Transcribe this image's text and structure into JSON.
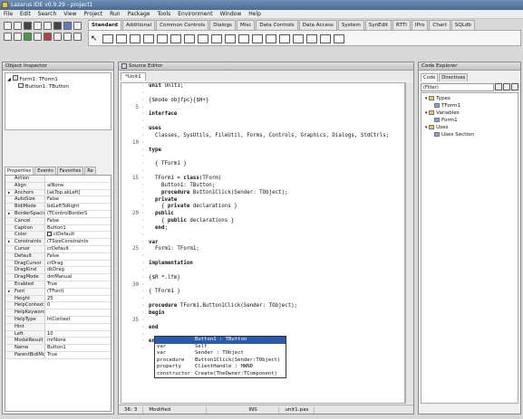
{
  "title": "Lazarus IDE v0.9.29 - project1",
  "menu": [
    "File",
    "Edit",
    "Search",
    "View",
    "Project",
    "Run",
    "Package",
    "Tools",
    "Environment",
    "Window",
    "Help"
  ],
  "palette_tabs": [
    "Standard",
    "Additional",
    "Common Controls",
    "Dialogs",
    "Misc",
    "Data Controls",
    "Data Access",
    "System",
    "SynEdit",
    "RTTI",
    "IPro",
    "Chart",
    "SQLdb"
  ],
  "palette_active": "Standard",
  "object_inspector": {
    "title": "Object Inspector",
    "tree": [
      "Form1: TForm1",
      "Button1: TButton"
    ],
    "tabs": [
      "Properties",
      "Events",
      "Favorites",
      "Re"
    ],
    "props": [
      {
        "k": "Action",
        "v": ""
      },
      {
        "k": "Align",
        "v": "alNone"
      },
      {
        "k": "Anchors",
        "v": "[akTop,akLeft]",
        "tri": "▸"
      },
      {
        "k": "AutoSize",
        "v": "False"
      },
      {
        "k": "BidiMode",
        "v": "bdLeftToRight"
      },
      {
        "k": "BorderSpacing",
        "v": "(TControlBorderS",
        "tri": "▸"
      },
      {
        "k": "Cancel",
        "v": "False"
      },
      {
        "k": "Caption",
        "v": "Button1"
      },
      {
        "k": "Color",
        "v": "clDefault"
      },
      {
        "k": "Constraints",
        "v": "(TSizeConstraints",
        "tri": "▸"
      },
      {
        "k": "Cursor",
        "v": "crDefault"
      },
      {
        "k": "Default",
        "v": "False"
      },
      {
        "k": "DragCursor",
        "v": "crDrag"
      },
      {
        "k": "DragKind",
        "v": "dkDrag"
      },
      {
        "k": "DragMode",
        "v": "dmManual"
      },
      {
        "k": "Enabled",
        "v": "True"
      },
      {
        "k": "Font",
        "v": "(TFont)",
        "tri": "▸"
      },
      {
        "k": "Height",
        "v": "25"
      },
      {
        "k": "HelpContext",
        "v": "0"
      },
      {
        "k": "HelpKeyword",
        "v": ""
      },
      {
        "k": "HelpType",
        "v": "htContext"
      },
      {
        "k": "Hint",
        "v": ""
      },
      {
        "k": "Left",
        "v": "10"
      },
      {
        "k": "ModalResult",
        "v": "mrNone"
      },
      {
        "k": "Name",
        "v": "Button1"
      },
      {
        "k": "ParentBidiMode",
        "v": "True"
      }
    ]
  },
  "source_editor": {
    "title": "Source Editor",
    "tab": "*Unit1",
    "lines": [
      {
        "n": "",
        "t": "unit Unit1;"
      },
      {
        "n": "",
        "t": ""
      },
      {
        "n": "",
        "t": "{$mode objfpc}{$H+}"
      },
      {
        "n": "5",
        "t": ""
      },
      {
        "n": "",
        "t": "interface"
      },
      {
        "n": "",
        "t": ""
      },
      {
        "n": "",
        "t": "uses"
      },
      {
        "n": "",
        "t": "  Classes, SysUtils, FileUtil, Forms, Controls, Graphics, Dialogs, StdCtrls;"
      },
      {
        "n": "10",
        "t": ""
      },
      {
        "n": "",
        "t": "type"
      },
      {
        "n": "",
        "t": ""
      },
      {
        "n": "",
        "t": "  { TForm1 }"
      },
      {
        "n": "",
        "t": ""
      },
      {
        "n": "15",
        "t": "  TForm1 = class(TForm)"
      },
      {
        "n": "",
        "t": "    Button1: TButton;"
      },
      {
        "n": "",
        "t": "    procedure Button1Click(Sender: TObject);"
      },
      {
        "n": "",
        "t": "  private"
      },
      {
        "n": "",
        "t": "    { private declarations }"
      },
      {
        "n": "20",
        "t": "  public"
      },
      {
        "n": "",
        "t": "    { public declarations }"
      },
      {
        "n": "",
        "t": "  end;"
      },
      {
        "n": "",
        "t": ""
      },
      {
        "n": "",
        "t": "var"
      },
      {
        "n": "25",
        "t": "  Form1: TForm1;"
      },
      {
        "n": "",
        "t": ""
      },
      {
        "n": "",
        "t": "implementation"
      },
      {
        "n": "",
        "t": ""
      },
      {
        "n": "",
        "t": "{$R *.lfm}"
      },
      {
        "n": "30",
        "t": ""
      },
      {
        "n": "",
        "t": "{ TForm1 }"
      },
      {
        "n": "",
        "t": ""
      },
      {
        "n": "",
        "t": "procedure TForm1.Button1Click(Sender: TObject);"
      },
      {
        "n": "",
        "t": "begin"
      },
      {
        "n": "35",
        "t": ""
      },
      {
        "n": "",
        "t": "end"
      },
      {
        "n": "",
        "t": ""
      },
      {
        "n": "",
        "t": "end"
      },
      {
        "n": "",
        "t": ""
      }
    ],
    "popup": [
      {
        "k": "",
        "v": "Button1 : TButton",
        "sel": true
      },
      {
        "k": "var",
        "v": "Self"
      },
      {
        "k": "var",
        "v": "Sender : TObject"
      },
      {
        "k": "procedure",
        "v": "Button1Click(Sender:TObject)"
      },
      {
        "k": "property",
        "v": "ClientHandle : HWND"
      },
      {
        "k": "constructor",
        "v": "Create(TheOwner:TComponent)"
      }
    ],
    "status": {
      "pos": "36: 3",
      "modified": "Modified",
      "ins": "INS",
      "file": "unit1.pas"
    }
  },
  "code_explorer": {
    "title": "Code Explorer",
    "tabs": [
      "Code",
      "Directives"
    ],
    "filter": "(Filter)",
    "tree": [
      {
        "d": 0,
        "t": "Types"
      },
      {
        "d": 1,
        "t": "TForm1"
      },
      {
        "d": 0,
        "t": "Variables"
      },
      {
        "d": 1,
        "t": "Form1"
      },
      {
        "d": 0,
        "t": "Uses"
      },
      {
        "d": 1,
        "t": "Uses Section"
      }
    ]
  }
}
